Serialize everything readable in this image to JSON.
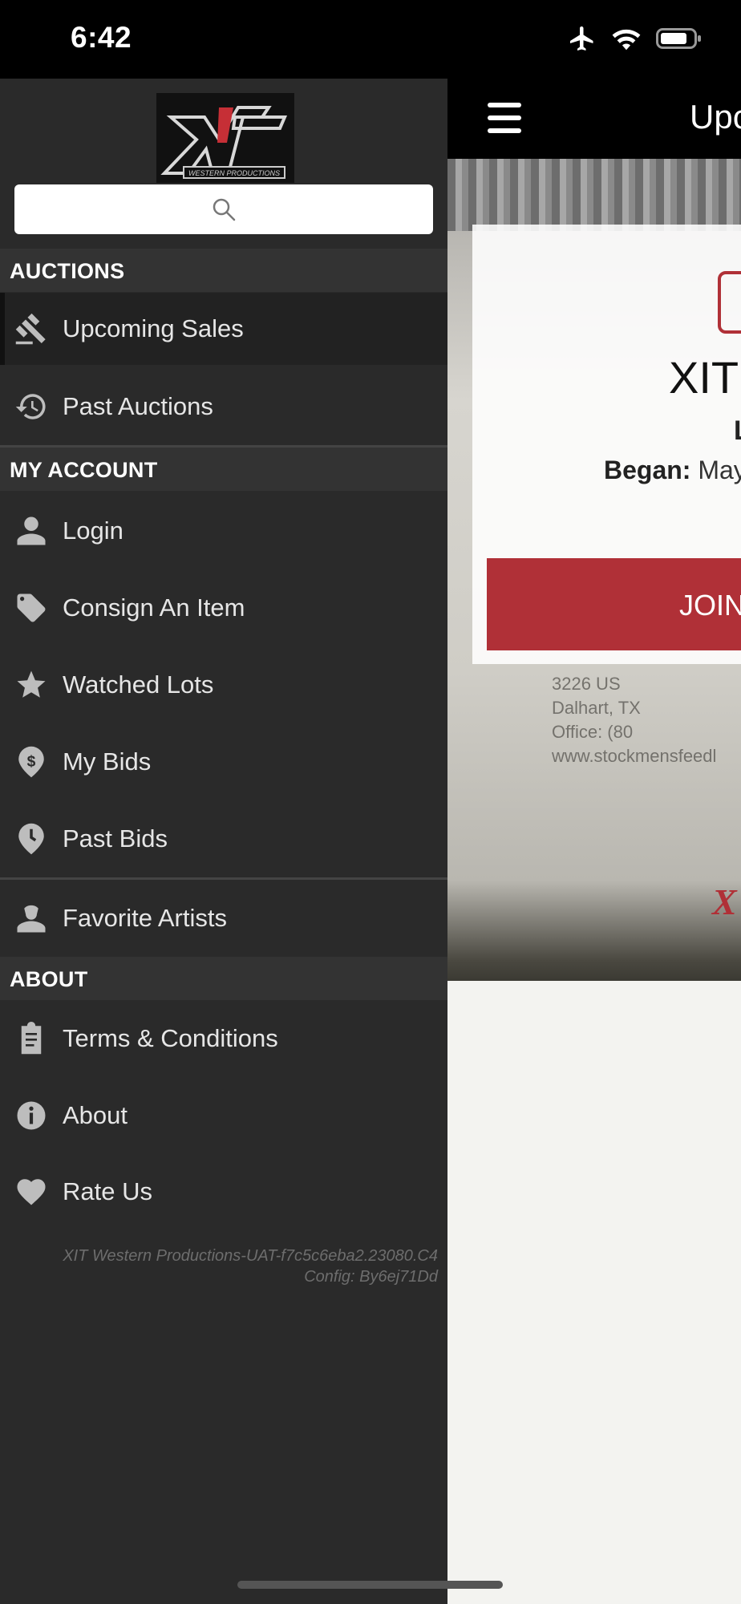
{
  "status_bar": {
    "time": "6:42"
  },
  "header": {
    "title": "Upc"
  },
  "hero": {
    "sign_lines": [
      "3226 US",
      "Dalhart, TX",
      "Office: (80",
      "www.stockmensfeedl"
    ],
    "logo_letter": "X"
  },
  "card": {
    "title": "XIT",
    "letter": "L",
    "began_label": "Began:",
    "began_value": "May",
    "join_label": "JOIN"
  },
  "drawer": {
    "logo_text": "WESTERN PRODUCTIONS",
    "sections": {
      "auctions": "AUCTIONS",
      "my_account": "MY ACCOUNT",
      "about": "ABOUT"
    },
    "items": {
      "upcoming_sales": "Upcoming Sales",
      "past_auctions": "Past Auctions",
      "login": "Login",
      "consign": "Consign An Item",
      "watched_lots": "Watched Lots",
      "my_bids": "My Bids",
      "past_bids": "Past Bids",
      "favorite_artists": "Favorite Artists",
      "terms": "Terms & Conditions",
      "about": "About",
      "rate_us": "Rate Us"
    },
    "version_line1": "XIT Western Productions-UAT-f7c5c6eba2.23080.C4",
    "version_line2": "Config: By6ej71Dd"
  },
  "colors": {
    "accent": "#b03037",
    "drawer_bg": "#2a2a2a",
    "section_bg": "#333333"
  }
}
